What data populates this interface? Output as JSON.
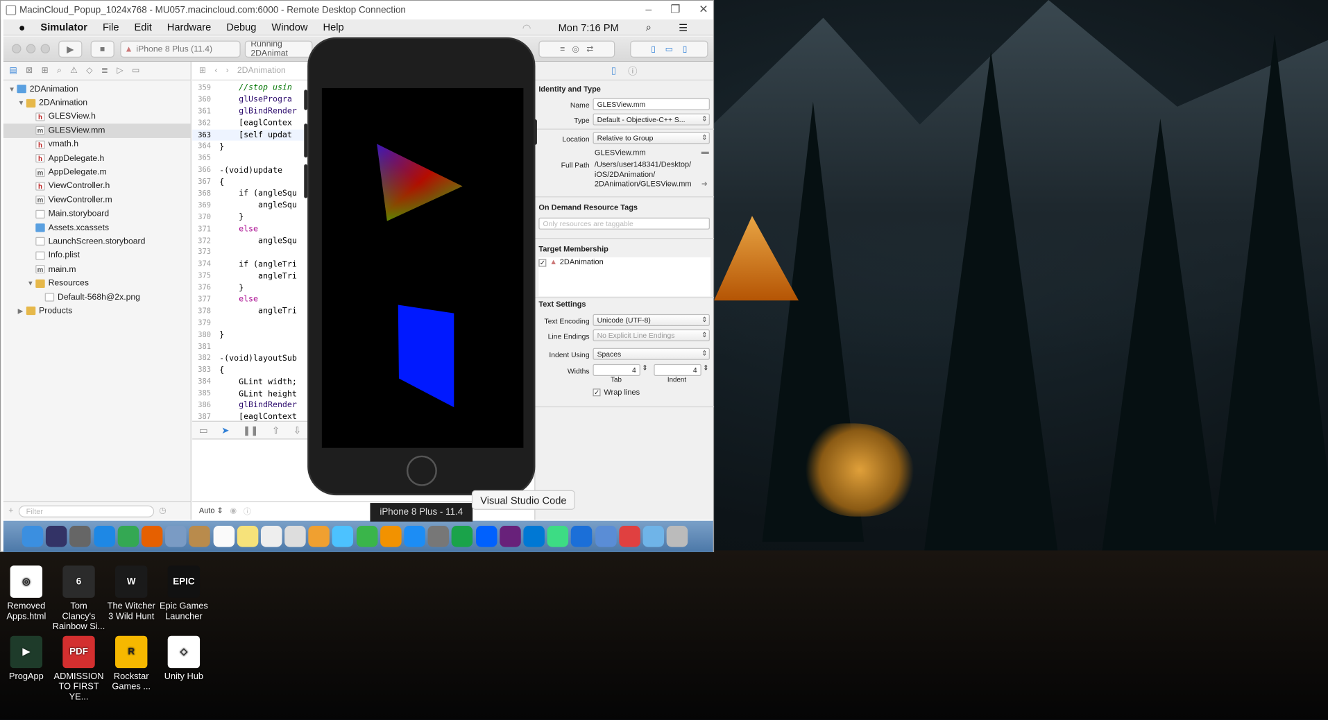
{
  "rdp": {
    "title": "MacinCloud_Popup_1024x768 - MU057.macincloud.com:6000 - Remote Desktop Connection",
    "controls": [
      "–",
      "❐",
      "✕"
    ]
  },
  "menubar": {
    "apple": "",
    "app": "Simulator",
    "items": [
      "File",
      "Edit",
      "Hardware",
      "Debug",
      "Window",
      "Help"
    ],
    "clock": "Mon 7:16 PM"
  },
  "toolbar": {
    "scheme": "iPhone 8 Plus (11.4)",
    "status": "Running 2DAnimat"
  },
  "navigator": {
    "items": [
      {
        "label": "2DAnimation",
        "type": "project",
        "indent": 0,
        "disc": "▼"
      },
      {
        "label": "2DAnimation",
        "type": "folder",
        "indent": 1,
        "disc": "▼"
      },
      {
        "label": "GLESView.h",
        "type": "h",
        "indent": 2,
        "disc": ""
      },
      {
        "label": "GLESView.mm",
        "type": "m",
        "indent": 2,
        "disc": "",
        "selected": true
      },
      {
        "label": "vmath.h",
        "type": "h",
        "indent": 2,
        "disc": ""
      },
      {
        "label": "AppDelegate.h",
        "type": "h",
        "indent": 2,
        "disc": ""
      },
      {
        "label": "AppDelegate.m",
        "type": "m",
        "indent": 2,
        "disc": ""
      },
      {
        "label": "ViewController.h",
        "type": "h",
        "indent": 2,
        "disc": ""
      },
      {
        "label": "ViewController.m",
        "type": "m",
        "indent": 2,
        "disc": ""
      },
      {
        "label": "Main.storyboard",
        "type": "doc",
        "indent": 2,
        "disc": ""
      },
      {
        "label": "Assets.xcassets",
        "type": "bluef",
        "indent": 2,
        "disc": ""
      },
      {
        "label": "LaunchScreen.storyboard",
        "type": "doc",
        "indent": 2,
        "disc": ""
      },
      {
        "label": "Info.plist",
        "type": "doc",
        "indent": 2,
        "disc": ""
      },
      {
        "label": "main.m",
        "type": "m",
        "indent": 2,
        "disc": ""
      },
      {
        "label": "Resources",
        "type": "folder",
        "indent": 2,
        "disc": "▼"
      },
      {
        "label": "Default-568h@2x.png",
        "type": "doc",
        "indent": 3,
        "disc": ""
      },
      {
        "label": "Products",
        "type": "folder",
        "indent": 1,
        "disc": "▶"
      }
    ],
    "filter_placeholder": "Filter"
  },
  "editor": {
    "breadcrumb": "2DAnimation",
    "current_line": "363",
    "lines": [
      {
        "n": "359",
        "code": "    //stop usin",
        "cls": "cm"
      },
      {
        "n": "360",
        "code": "    glUseProgra",
        "cls": "fn"
      },
      {
        "n": "361",
        "code": "    glBindRender",
        "cls": "fn"
      },
      {
        "n": "362",
        "code": "    [eaglContex",
        "cls": ""
      },
      {
        "n": "363",
        "code": "    [self updat",
        "cls": ""
      },
      {
        "n": "364",
        "code": "}",
        "cls": ""
      },
      {
        "n": "365",
        "code": "",
        "cls": ""
      },
      {
        "n": "366",
        "code": "-(void)update",
        "cls": ""
      },
      {
        "n": "367",
        "code": "{",
        "cls": ""
      },
      {
        "n": "368",
        "code": "    if (angleSqu",
        "cls": ""
      },
      {
        "n": "369",
        "code": "        angleSqu",
        "cls": ""
      },
      {
        "n": "370",
        "code": "    }",
        "cls": ""
      },
      {
        "n": "371",
        "code": "    else",
        "cls": "kw"
      },
      {
        "n": "372",
        "code": "        angleSqu",
        "cls": ""
      },
      {
        "n": "373",
        "code": "",
        "cls": ""
      },
      {
        "n": "374",
        "code": "    if (angleTri",
        "cls": ""
      },
      {
        "n": "375",
        "code": "        angleTri",
        "cls": ""
      },
      {
        "n": "376",
        "code": "    }",
        "cls": ""
      },
      {
        "n": "377",
        "code": "    else",
        "cls": "kw"
      },
      {
        "n": "378",
        "code": "        angleTri",
        "cls": ""
      },
      {
        "n": "379",
        "code": "",
        "cls": ""
      },
      {
        "n": "380",
        "code": "}",
        "cls": ""
      },
      {
        "n": "381",
        "code": "",
        "cls": ""
      },
      {
        "n": "382",
        "code": "-(void)layoutSub",
        "cls": ""
      },
      {
        "n": "383",
        "code": "{",
        "cls": ""
      },
      {
        "n": "384",
        "code": "    GLint width;",
        "cls": ""
      },
      {
        "n": "385",
        "code": "    GLint height",
        "cls": ""
      },
      {
        "n": "386",
        "code": "    glBindRender",
        "cls": "fn"
      },
      {
        "n": "387",
        "code": "    [eaglContext",
        "cls": ""
      }
    ],
    "bottom_auto": "Auto ⇕"
  },
  "inspector": {
    "identity_title": "Identity and Type",
    "name_label": "Name",
    "name_value": "GLESView.mm",
    "type_label": "Type",
    "type_value": "Default - Objective-C++ S...",
    "location_label": "Location",
    "location_value": "Relative to Group",
    "location_file": "GLESView.mm",
    "fullpath_label": "Full Path",
    "fullpath_1": "/Users/user148341/Desktop/",
    "fullpath_2": "iOS/2DAnimation/",
    "fullpath_3": "2DAnimation/GLESView.mm",
    "odr_title": "On Demand Resource Tags",
    "odr_placeholder": "Only resources are taggable",
    "target_title": "Target Membership",
    "target_name": "2DAnimation",
    "text_title": "Text Settings",
    "encoding_label": "Text Encoding",
    "encoding_value": "Unicode (UTF-8)",
    "endings_label": "Line Endings",
    "endings_value": "No Explicit Line Endings",
    "indent_label": "Indent Using",
    "indent_value": "Spaces",
    "widths_label": "Widths",
    "tab_value": "4",
    "indent_num": "4",
    "tab_caption": "Tab",
    "indent_caption": "Indent",
    "wrap_label": "Wrap lines"
  },
  "tooltips": {
    "simulator": "iPhone 8 Plus - 11.4",
    "vscode": "Visual Studio Code"
  },
  "dock": [
    {
      "icon": "finder-icon",
      "color": "#3b8fe0"
    },
    {
      "icon": "siri-icon",
      "color": "#333366"
    },
    {
      "icon": "launchpad-icon",
      "color": "#666"
    },
    {
      "icon": "safari-icon",
      "color": "#1e88e5"
    },
    {
      "icon": "chrome-icon",
      "color": "#34a853"
    },
    {
      "icon": "firefox-icon",
      "color": "#e66000"
    },
    {
      "icon": "preview-icon",
      "color": "#7a9bc4"
    },
    {
      "icon": "contacts-icon",
      "color": "#b98b4c"
    },
    {
      "icon": "calendar-icon",
      "color": "#fafafa"
    },
    {
      "icon": "notes-icon",
      "color": "#f6e27a"
    },
    {
      "icon": "reminders-icon",
      "color": "#eee"
    },
    {
      "icon": "pages-icon",
      "color": "#ddd"
    },
    {
      "icon": "photos-icon",
      "color": "#f0a030"
    },
    {
      "icon": "messages-icon",
      "color": "#4cc2ff"
    },
    {
      "icon": "facetime-icon",
      "color": "#3ab54a"
    },
    {
      "icon": "ibooks-icon",
      "color": "#f29200"
    },
    {
      "icon": "appstore-icon",
      "color": "#1c8df5"
    },
    {
      "icon": "system-prefs-icon",
      "color": "#777"
    },
    {
      "icon": "evernote-icon",
      "color": "#1aa34a"
    },
    {
      "icon": "dropbox-icon",
      "color": "#0061fe"
    },
    {
      "icon": "visual-studio-icon",
      "color": "#68217a"
    },
    {
      "icon": "vscode-icon",
      "color": "#0078d4"
    },
    {
      "icon": "android-studio-icon",
      "color": "#3ddc84"
    },
    {
      "icon": "xcode-icon",
      "color": "#1b6fd8"
    },
    {
      "icon": "simulator-icon",
      "color": "#5a8dd6"
    },
    {
      "icon": "folder-icon",
      "color": "#e04040"
    },
    {
      "icon": "downloads-icon",
      "color": "#6fb4e8"
    },
    {
      "icon": "trash-icon",
      "color": "#bbb"
    }
  ],
  "desktop_icons": [
    {
      "label": "Removed Apps.html",
      "icon": "chrome-icon",
      "bg": "#ffffff",
      "glyph": "◎"
    },
    {
      "label": "Tom Clancy's Rainbow Si...",
      "icon": "rainbow-six-icon",
      "bg": "#2b2b2b",
      "glyph": "6"
    },
    {
      "label": "The Witcher 3 Wild Hunt",
      "icon": "witcher-icon",
      "bg": "#1a1a1a",
      "glyph": "W"
    },
    {
      "label": "Epic Games Launcher",
      "icon": "epic-games-icon",
      "bg": "#111111",
      "glyph": "EPIC"
    },
    {
      "label": "ProgApp",
      "icon": "progapp-icon",
      "bg": "#1e3b2a",
      "glyph": "▶"
    },
    {
      "label": "ADMISSION TO FIRST YE...",
      "icon": "pdf-icon",
      "bg": "#d32f2f",
      "glyph": "PDF"
    },
    {
      "label": "Rockstar Games ...",
      "icon": "rockstar-icon",
      "bg": "#f6b800",
      "glyph": "R"
    },
    {
      "label": "Unity Hub",
      "icon": "unity-icon",
      "bg": "#ffffff",
      "glyph": "◇"
    }
  ]
}
